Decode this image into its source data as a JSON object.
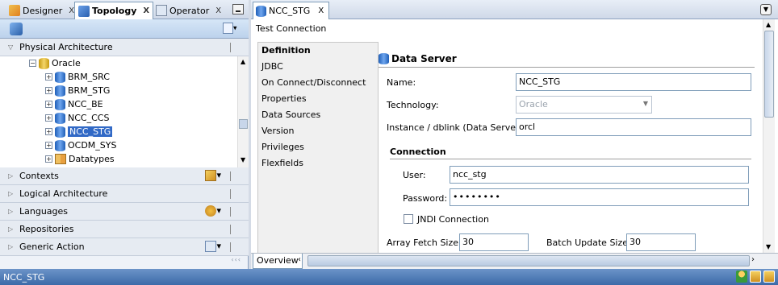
{
  "left_panel": {
    "tabs": [
      {
        "label": "Designer",
        "close": "X"
      },
      {
        "label": "Topology",
        "close": "X"
      },
      {
        "label": "Operator",
        "close": "X"
      }
    ],
    "physical_section": "Physical Architecture",
    "tree": {
      "root": "Oracle",
      "children": [
        "BRM_SRC",
        "BRM_STG",
        "NCC_BE",
        "NCC_CCS",
        "NCC_STG",
        "OCDM_SYS",
        "Datatypes"
      ],
      "selected": "NCC_STG"
    },
    "sections": [
      "Contexts",
      "Logical Architecture",
      "Languages",
      "Repositories",
      "Generic Action"
    ]
  },
  "right_panel": {
    "tab_label": "NCC_STG",
    "tab_close": "X",
    "toolbar_label": "Test Connection",
    "nav_items": [
      "Definition",
      "JDBC",
      "On Connect/Disconnect",
      "Properties",
      "Data Sources",
      "Version",
      "Privileges",
      "Flexfields"
    ],
    "form": {
      "title": "Data Server",
      "name_label": "Name:",
      "name_value": "NCC_STG",
      "technology_label": "Technology:",
      "technology_value": "Oracle",
      "instance_label": "Instance / dblink (Data Server):",
      "instance_value": "orcl",
      "connection_header": "Connection",
      "user_label": "User:",
      "user_value": "ncc_stg",
      "password_label": "Password:",
      "password_value": "••••••••",
      "jndi_label": "JNDI Connection",
      "array_fetch_label": "Array Fetch Size:",
      "array_fetch_value": "30",
      "batch_update_label": "Batch Update Size:",
      "batch_update_value": "30"
    },
    "overview_tab": "Overview"
  },
  "status_bar": {
    "text": "NCC_STG"
  }
}
